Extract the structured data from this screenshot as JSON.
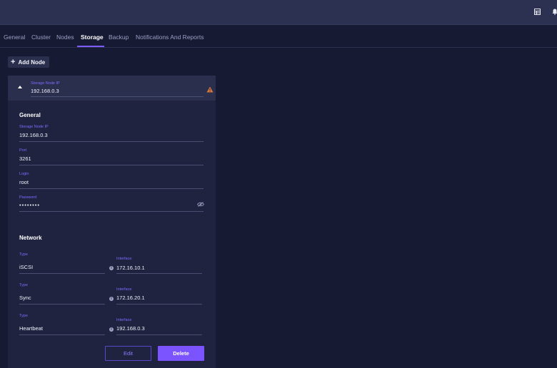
{
  "topbar": {
    "icons": [
      "table-icon",
      "bell-icon"
    ]
  },
  "tabs": [
    {
      "label": "General"
    },
    {
      "label": "Cluster"
    },
    {
      "label": "Nodes"
    },
    {
      "label": "Storage",
      "active": true
    },
    {
      "label": "Backup"
    },
    {
      "label": "Notifications And Reports"
    }
  ],
  "toolbar": {
    "add_node_label": "Add Node"
  },
  "node": {
    "header_label": "Storage Node IP",
    "header_value": "192.168.0.3",
    "general": {
      "title": "General",
      "storage_ip_label": "Storage Node IP",
      "storage_ip_value": "192.168.0.3",
      "port_label": "Port",
      "port_value": "3261",
      "login_label": "Login",
      "login_value": "root",
      "password_label": "Password",
      "password_value": "••••••••"
    },
    "network": {
      "title": "Network",
      "rows": [
        {
          "type_label": "Type",
          "type_value": "iSCSI",
          "interface_label": "Interface",
          "interface_value": "172.16.10.1"
        },
        {
          "type_label": "Type",
          "type_value": "Sync",
          "interface_label": "Interface",
          "interface_value": "172.16.20.1"
        },
        {
          "type_label": "Type",
          "type_value": "Heartbeat",
          "interface_label": "Interface",
          "interface_value": "192.168.0.3"
        }
      ]
    },
    "actions": {
      "edit_label": "Edit",
      "delete_label": "Delete"
    }
  },
  "colors": {
    "accent": "#7b54ff",
    "warning": "#d9773a",
    "background": "#171a33"
  }
}
